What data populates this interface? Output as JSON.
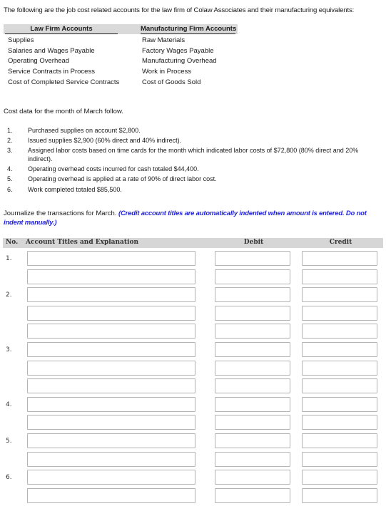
{
  "intro": "The following are the job cost related accounts for the law firm of Colaw Associates and their manufacturing equivalents:",
  "accounts_table": {
    "headers": [
      "Law Firm Accounts",
      "Manufacturing Firm Accounts"
    ],
    "rows": [
      [
        "Supplies",
        "Raw Materials"
      ],
      [
        "Salaries and Wages Payable",
        "Factory Wages Payable"
      ],
      [
        "Operating Overhead",
        "Manufacturing Overhead"
      ],
      [
        "Service Contracts in Process",
        "Work in Process"
      ],
      [
        "Cost of Completed Service Contracts",
        "Cost of Goods Sold"
      ]
    ]
  },
  "cost_data": {
    "intro": "Cost data for the month of March follow.",
    "items": [
      {
        "num": "1.",
        "text": "Purchased supplies on account $2,800."
      },
      {
        "num": "2.",
        "text": "Issued supplies $2,900 (60% direct and 40% indirect)."
      },
      {
        "num": "3.",
        "text": "Assigned labor costs based on time cards for the month which indicated labor costs of $72,800 (80% direct and 20% indirect)."
      },
      {
        "num": "4.",
        "text": "Operating overhead costs incurred for cash totaled $44,400."
      },
      {
        "num": "5.",
        "text": "Operating overhead is applied at a rate of 90% of direct labor cost."
      },
      {
        "num": "6.",
        "text": "Work completed totaled $85,500."
      }
    ]
  },
  "journal": {
    "instruction": "Journalize the transactions for March.",
    "note": "(Credit account titles are automatically indented when amount is entered. Do not indent manually.)",
    "headers": {
      "no": "No.",
      "account": "Account Titles and Explanation",
      "debit": "Debit",
      "credit": "Credit"
    },
    "rows": [
      {
        "no": "1.",
        "account": "",
        "debit": "",
        "credit": ""
      },
      {
        "no": "",
        "account": "",
        "debit": "",
        "credit": ""
      },
      {
        "no": "2.",
        "account": "",
        "debit": "",
        "credit": ""
      },
      {
        "no": "",
        "account": "",
        "debit": "",
        "credit": ""
      },
      {
        "no": "",
        "account": "",
        "debit": "",
        "credit": ""
      },
      {
        "no": "3.",
        "account": "",
        "debit": "",
        "credit": ""
      },
      {
        "no": "",
        "account": "",
        "debit": "",
        "credit": ""
      },
      {
        "no": "",
        "account": "",
        "debit": "",
        "credit": ""
      },
      {
        "no": "4.",
        "account": "",
        "debit": "",
        "credit": ""
      },
      {
        "no": "",
        "account": "",
        "debit": "",
        "credit": ""
      },
      {
        "no": "5.",
        "account": "",
        "debit": "",
        "credit": ""
      },
      {
        "no": "",
        "account": "",
        "debit": "",
        "credit": ""
      },
      {
        "no": "6.",
        "account": "",
        "debit": "",
        "credit": ""
      },
      {
        "no": "",
        "account": "",
        "debit": "",
        "credit": ""
      }
    ]
  },
  "colors": {
    "note_blue": "#1f1fe0",
    "header_gray": "#d6d6d6"
  }
}
